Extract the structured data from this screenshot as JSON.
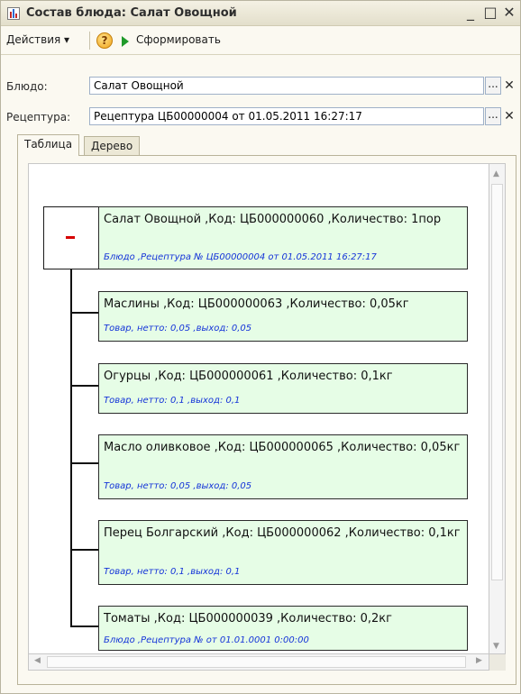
{
  "window": {
    "title": "Состав блюда: Салат Овощной",
    "min_glyph": "_",
    "max_glyph": "□",
    "close_glyph": "✕"
  },
  "toolbar": {
    "actions_label": "Действия ▾",
    "help_glyph": "?",
    "form_label": "Сформировать"
  },
  "fields": {
    "dish_label": "Блюдо:",
    "dish_value": "Салат Овощной",
    "recipe_label": "Рецептура:",
    "recipe_value": "Рецептура ЦБ00000004 от 01.05.2011 16:27:17",
    "dots": "...",
    "clear": "✕"
  },
  "tabs": [
    {
      "label": "Таблица",
      "active": true
    },
    {
      "label": "Дерево",
      "active": false
    }
  ],
  "tree": {
    "root": {
      "main": "Салат Овощной ,Код: ЦБ000000060 ,Количество: 1пор",
      "sub": "Блюдо ,Рецептура № ЦБ00000004 от 01.05.2011 16:27:17"
    },
    "children": [
      {
        "main": "Маслины ,Код: ЦБ000000063 ,Количество: 0,05кг",
        "sub": "Товар, нетто: 0,05 ,выход: 0,05"
      },
      {
        "main": "Огурцы ,Код: ЦБ000000061 ,Количество: 0,1кг",
        "sub": "Товар, нетто: 0,1 ,выход: 0,1"
      },
      {
        "main": "Масло оливковое ,Код: ЦБ000000065 ,Количество: 0,05кг",
        "sub": "Товар, нетто: 0,05 ,выход: 0,05"
      },
      {
        "main": "Перец Болгарский ,Код: ЦБ000000062 ,Количество: 0,1кг",
        "sub": "Товар, нетто: 0,1 ,выход: 0,1"
      },
      {
        "main": "Томаты ,Код: ЦБ000000039 ,Количество: 0,2кг",
        "sub": "Блюдо ,Рецептура №          от 01.01.0001 0:00:00"
      }
    ]
  },
  "colors": {
    "node_fill": "#e6fde6",
    "sub_text": "#1434d8",
    "minus": "#d60000"
  }
}
